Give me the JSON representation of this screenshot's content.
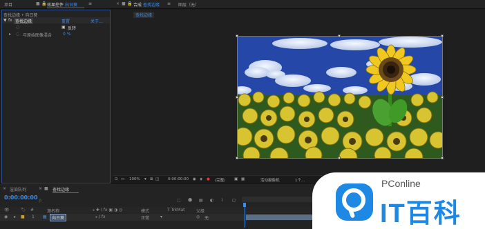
{
  "top_bar": {
    "project_tab": "项目",
    "effects_tab_prefix": "效果控件",
    "effects_tab_layer": "向日葵",
    "comp_tab_prefix": "合成",
    "comp_tab_name": "查找边缘",
    "layer_tab": "图层（无）"
  },
  "effects_panel": {
    "breadcrumb": "查找边缘 • 向日葵",
    "effect_name": "查找边缘",
    "reset_label": "重置",
    "about_label": "关于...",
    "invert_label": "反转",
    "blend_label": "与原始图像混合",
    "blend_value": "0 %"
  },
  "viewer": {
    "comp_tab": "查找边缘",
    "zoom": "100%",
    "timecode": "0:00:00:00",
    "resolution": "(完整)",
    "camera": "活动摄像机",
    "views": "1个..."
  },
  "timeline": {
    "render_queue_tab": "渲染队列",
    "comp_tab": "查找边缘",
    "timecode": "0:00:00:00",
    "search_placeholder": "ρ.",
    "col_source_name": "源名称",
    "col_mode": "模式",
    "col_trkmat": "T TrkMat",
    "col_parent": "父级",
    "layer_index": "1",
    "layer_name": "向日葵",
    "layer_mode": "正常",
    "layer_parent": "无"
  },
  "watermark": {
    "brand_small": "PConline",
    "brand_big": "IT百科"
  },
  "colors": {
    "accent_blue": "#3f8be8",
    "panel_bg": "#232323",
    "sky_blue": "#2a52b4",
    "sunflower_yellow": "#e8c42a",
    "watermark_blue": "#1e88e5"
  }
}
